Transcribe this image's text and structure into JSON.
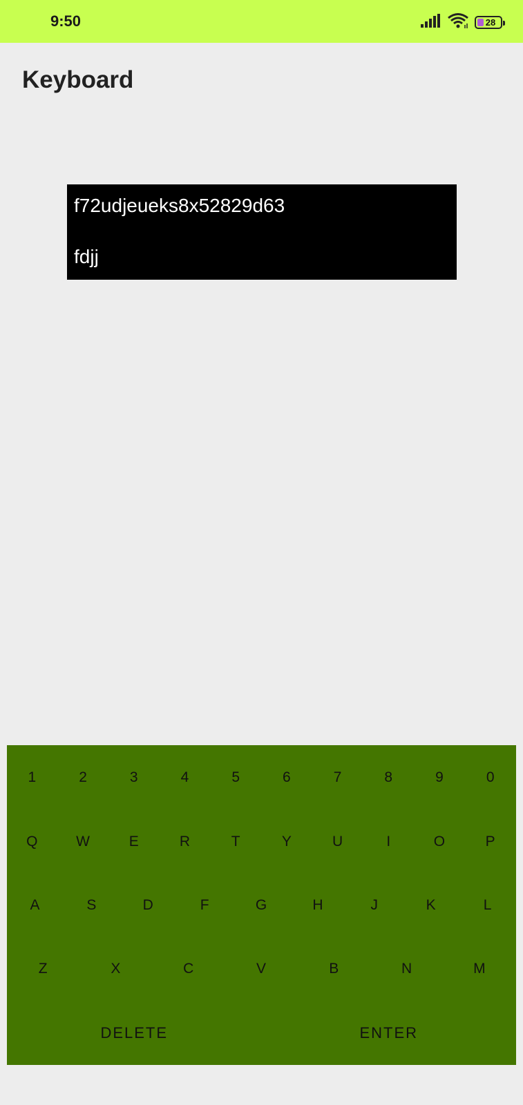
{
  "status_bar": {
    "time": "9:50",
    "battery_level": "28",
    "battery_fill_color": "#b05cd6",
    "background_color": "#c8ff50",
    "icons": [
      "signal-icon",
      "wifi-icon",
      "battery-icon"
    ]
  },
  "page": {
    "title": "Keyboard",
    "background_color": "#ededed"
  },
  "display": {
    "lines": [
      "f72udjeueks8x52829d63",
      "fdjj"
    ],
    "background_color": "#000000",
    "text_color": "#ffffff"
  },
  "keyboard": {
    "background_color": "#447600",
    "rows": [
      [
        "1",
        "2",
        "3",
        "4",
        "5",
        "6",
        "7",
        "8",
        "9",
        "0"
      ],
      [
        "Q",
        "W",
        "E",
        "R",
        "T",
        "Y",
        "U",
        "I",
        "O",
        "P"
      ],
      [
        "A",
        "S",
        "D",
        "F",
        "G",
        "H",
        "J",
        "K",
        "L"
      ],
      [
        "Z",
        "X",
        "C",
        "V",
        "B",
        "N",
        "M"
      ],
      [
        "DELETE",
        "ENTER"
      ]
    ]
  }
}
